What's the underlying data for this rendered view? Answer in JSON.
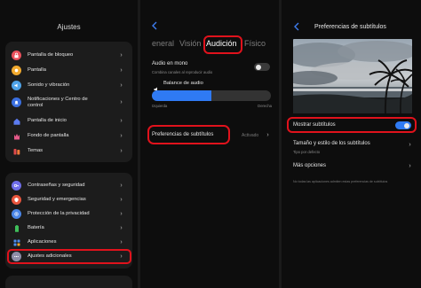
{
  "settings": {
    "title": "Ajustes",
    "group1": [
      {
        "label": "Pantalla de bloqueo",
        "icon": "lock-icon",
        "color": "#e8505b"
      },
      {
        "label": "Pantalla",
        "icon": "sun-icon",
        "color": "#f0a92e"
      },
      {
        "label": "Sonido y vibración",
        "icon": "speaker-icon",
        "color": "#4fa3e8"
      },
      {
        "label": "Notificaciones y Centro de control",
        "icon": "bell-icon",
        "color": "#3a6fe0"
      },
      {
        "label": "Pantalla de inicio",
        "icon": "home-icon",
        "color": "#5c7cf0"
      },
      {
        "label": "Fondo de pantalla",
        "icon": "flower-icon",
        "color": "#e65a8a"
      },
      {
        "label": "Temas",
        "icon": "palette-icon",
        "color": "#e04a4a"
      }
    ],
    "group2": [
      {
        "label": "Contraseñas y seguridad",
        "icon": "key-icon",
        "color": "#6f6de8"
      },
      {
        "label": "Seguridad y emergencias",
        "icon": "shield-icon",
        "color": "#e8553d"
      },
      {
        "label": "Protección de la privacidad",
        "icon": "privacy-icon",
        "color": "#4a86e8"
      },
      {
        "label": "Batería",
        "icon": "battery-icon",
        "color": "#3fbf5a"
      },
      {
        "label": "Aplicaciones",
        "icon": "apps-icon",
        "color": "#4e8ef0"
      },
      {
        "label": "Ajustes adicionales",
        "icon": "more-icon",
        "color": "#8e8ea8"
      }
    ]
  },
  "accessibility": {
    "tabs": [
      "eneral",
      "Visión",
      "Audición",
      "Físico"
    ],
    "active_tab": "Audición",
    "mono_audio": {
      "label": "Audio en mono",
      "description": "Combina canales al reproducir audio",
      "enabled": false
    },
    "balance": {
      "label": "Balance de audio",
      "left": "Izquierda",
      "right": "Derecha",
      "level": 0.5
    },
    "subtitles": {
      "label": "Preferencias de subtítulos",
      "status": "Activado"
    }
  },
  "subtitle_prefs": {
    "title": "Preferencias de subtítulos",
    "show_subtitles": {
      "label": "Mostrar subtítulos",
      "enabled": true
    },
    "size_style": {
      "label": "Tamaño y estilo de los subtítulos",
      "sub": "Tipo por defecto"
    },
    "more_options": {
      "label": "Más opciones"
    },
    "note": "No todas las aplicaciones admiten estas preferencias de subtítulos"
  },
  "colors": {
    "accent": "#2f7af3",
    "highlight": "#e0121c",
    "panel": "#0d0d0d",
    "card": "#1c1c1c"
  }
}
